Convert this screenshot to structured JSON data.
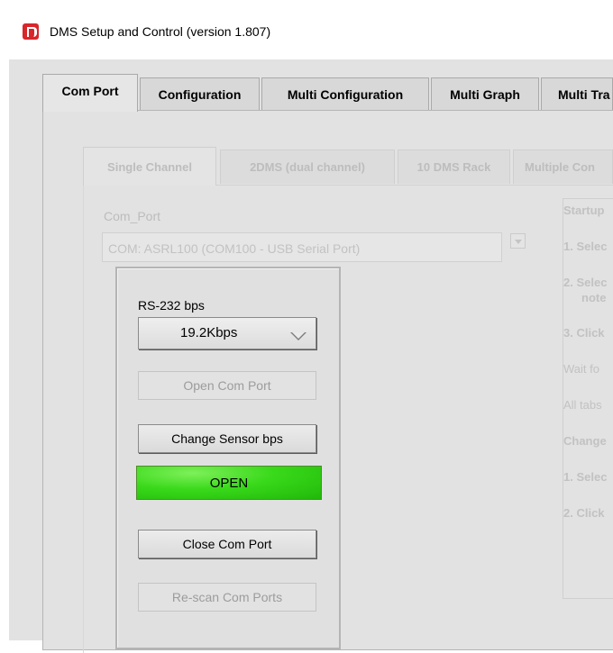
{
  "window": {
    "title": "DMS Setup and Control (version 1.807)"
  },
  "main_tabs": [
    {
      "label": "Com Port",
      "active": true
    },
    {
      "label": "Configuration"
    },
    {
      "label": "Multi Configuration"
    },
    {
      "label": "Multi Graph"
    },
    {
      "label": "Multi Tra"
    }
  ],
  "sub_tabs": [
    {
      "label": "Single Channel",
      "active": true
    },
    {
      "label": "2DMS (dual channel)"
    },
    {
      "label": "10 DMS Rack"
    },
    {
      "label": "Multiple Con"
    }
  ],
  "com_port": {
    "label": "Com_Port",
    "value": "COM: ASRL100  (COM100 - USB Serial Port)"
  },
  "controls": {
    "bps_label": "RS-232 bps",
    "bps_value": "19.2Kbps",
    "open_button": "Open Com Port",
    "change_button": "Change Sensor bps",
    "status": "OPEN",
    "status_color": "#39d91a",
    "close_button": "Close Com Port",
    "rescan_button": "Re-scan Com Ports"
  },
  "instructions": {
    "startup_heading": "Startup",
    "step1": "1. Selec",
    "step2a": "2. Selec",
    "step2b": "note",
    "step3": "3. Click",
    "wait": "Wait fo",
    "all_tabs": "All tabs",
    "change_heading": "Change",
    "c_step1": "1. Selec",
    "c_step2": "2. Click"
  }
}
